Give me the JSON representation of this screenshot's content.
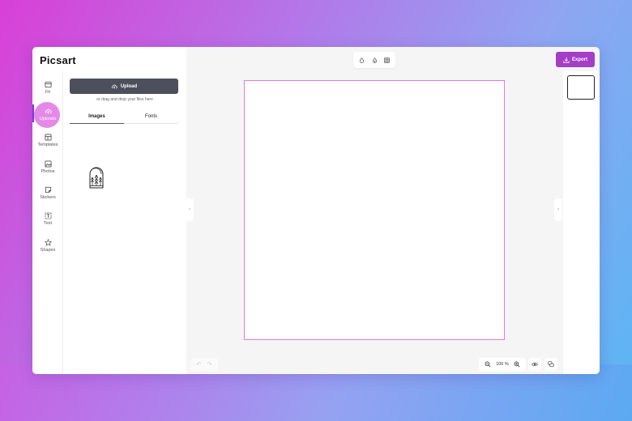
{
  "app": {
    "logo": "Picsart"
  },
  "rail": {
    "items": [
      {
        "label": "Fit",
        "icon": "fit-icon"
      },
      {
        "label": "Uploads",
        "icon": "upload-cloud-icon"
      },
      {
        "label": "Templates",
        "icon": "templates-icon"
      },
      {
        "label": "Photos",
        "icon": "photos-icon"
      },
      {
        "label": "Stickers",
        "icon": "stickers-icon"
      },
      {
        "label": "Text",
        "icon": "text-icon"
      },
      {
        "label": "Shapes",
        "icon": "star-icon"
      }
    ],
    "active": "Uploads"
  },
  "panel": {
    "upload_label": "Upload",
    "drop_hint": "or drag and drop your files here",
    "tabs": [
      {
        "label": "Images"
      },
      {
        "label": "Fonts"
      }
    ]
  },
  "toolbar": {
    "export_label": "Export"
  },
  "zoom": {
    "value": "100 %"
  },
  "colors": {
    "accent": "#a43ec6",
    "artboard_border": "#e07ae0",
    "active_rail": "#e27ce6",
    "upload_button": "#4d4f5c"
  }
}
